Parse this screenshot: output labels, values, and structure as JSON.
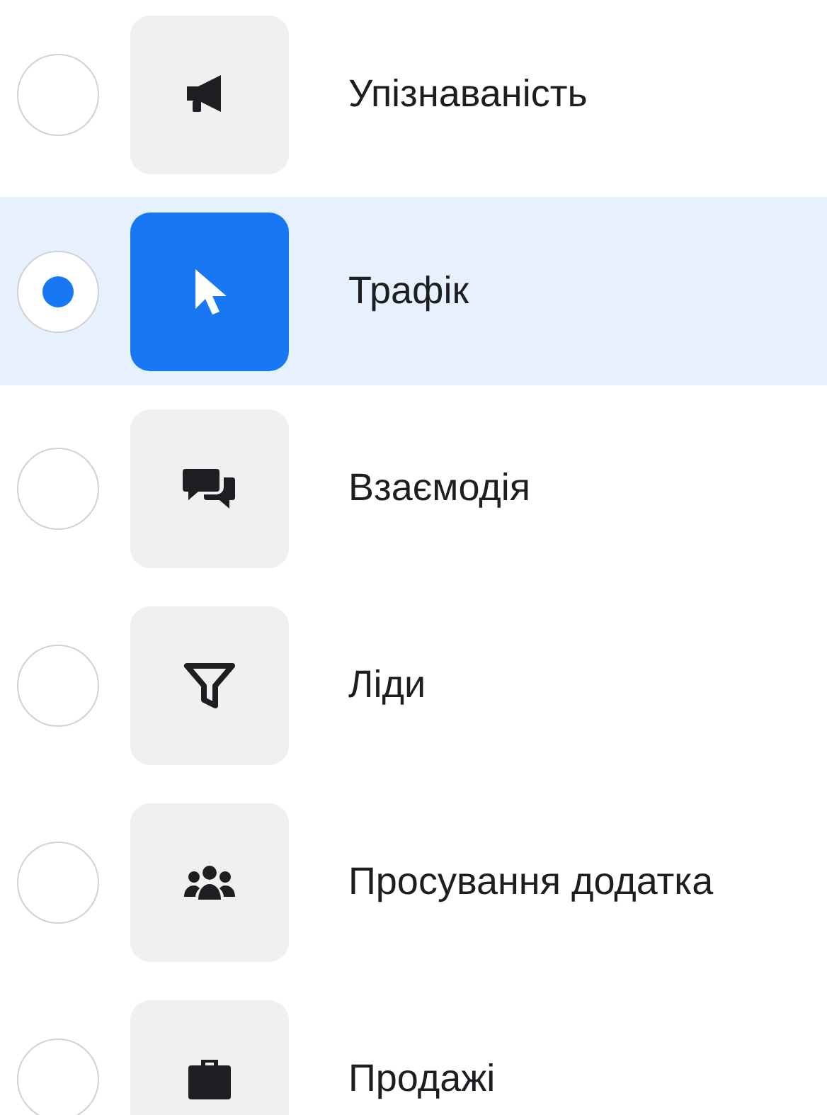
{
  "options": [
    {
      "kind": "megaphone",
      "label": "Упізнаваність",
      "selected": false
    },
    {
      "kind": "cursor",
      "label": "Трафік",
      "selected": true
    },
    {
      "kind": "chat",
      "label": "Взаємодія",
      "selected": false
    },
    {
      "kind": "funnel",
      "label": "Ліди",
      "selected": false
    },
    {
      "kind": "people",
      "label": "Просування додатка",
      "selected": false
    },
    {
      "kind": "briefcase",
      "label": "Продажі",
      "selected": false
    }
  ]
}
